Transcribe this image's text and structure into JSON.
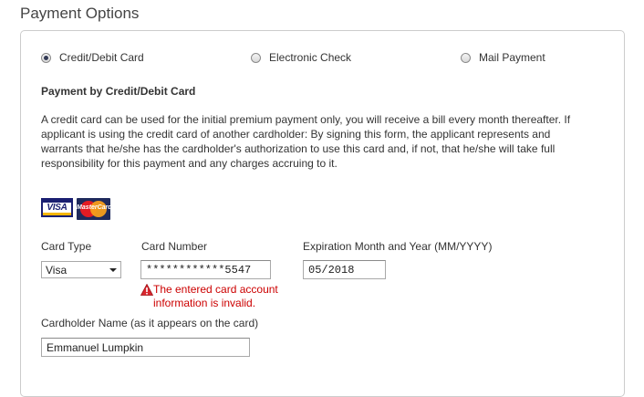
{
  "section_title": "Payment Options",
  "payment_methods": [
    {
      "label": "Credit/Debit Card",
      "selected": true
    },
    {
      "label": "Electronic Check",
      "selected": false
    },
    {
      "label": "Mail Payment",
      "selected": false
    }
  ],
  "sub_heading": "Payment by Credit/Debit Card",
  "description": "A credit card can be used for the initial premium payment only, you will receive a bill every month thereafter. If applicant is using the credit card of another cardholder: By signing this form, the applicant represents and warrants that he/she has the cardholder's authorization to use this card and, if not, that he/she will take full responsibility for this payment and any charges accruing to it.",
  "card_logos": {
    "visa": "VISA",
    "mastercard": "MasterCard"
  },
  "form": {
    "card_type_label": "Card Type",
    "card_type_value": "Visa",
    "card_number_label": "Card Number",
    "card_number_value": "************5547",
    "card_number_error": "The entered card account information is invalid.",
    "expiration_label": "Expiration Month and Year (MM/YYYY)",
    "expiration_value": "05/2018",
    "cardholder_label": "Cardholder Name (as it appears on the card)",
    "cardholder_value": "Emmanuel Lumpkin"
  },
  "colors": {
    "error": "#cc0000",
    "panel_border": "#cccccc"
  }
}
